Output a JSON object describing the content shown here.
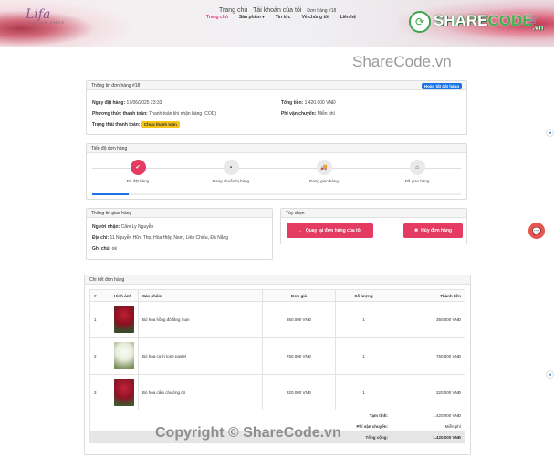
{
  "header": {
    "logo_text": "Lifa",
    "logo_sub": "FLOWER SHOP",
    "breadcrumb": [
      "Trang chủ",
      "Tài khoản của tôi",
      "Đơn hàng #18"
    ],
    "nav": [
      "Trang chủ",
      "Sản phẩm ▾",
      "Tin tức",
      "Về chúng tôi",
      "Liên hệ"
    ],
    "brand_prefix": "SHARE",
    "brand_mid": "CODE",
    "brand_suffix": ".vn",
    "cart_icon": "cart-icon"
  },
  "watermark": "ShareCode.vn",
  "order_info": {
    "title": "Thông tin đơn hàng #18",
    "status_badge": "Hoàn tất đặt hàng",
    "order_date_label": "Ngày đặt hàng:",
    "order_date": "17/06/2025 23:33",
    "payment_label": "Phương thức thanh toán:",
    "payment": "Thanh toán khi nhận hàng (COD)",
    "pay_status_label": "Trạng thái thanh toán:",
    "pay_status": "Chưa thanh toán",
    "total_label": "Tổng tiền:",
    "total": "1.420.000 VNĐ",
    "shipping_label": "Phí vận chuyển:",
    "shipping": "Miễn phí"
  },
  "progress": {
    "title": "Tiến độ đơn hàng",
    "steps": [
      "Đã đặt hàng",
      "Đang chuẩn bị hàng",
      "Đang giao hàng",
      "Đã giao hàng"
    ],
    "fill_fraction": 0.1
  },
  "shipping_info": {
    "title": "Thông tin giao hàng",
    "receiver_label": "Người nhận:",
    "receiver": "Cẩm Ly Nguyễn",
    "address_label": "Địa chỉ:",
    "address": "11 Nguyễn Hữu Thọ, Hòa Hiệp Nam, Liên Chiểu, Đà Nẵng",
    "note_label": "Ghi chú:",
    "note": "ok"
  },
  "options": {
    "title": "Tùy chọn",
    "back_button": "Quay lại đơn hàng của tôi",
    "cancel_button": "Hủy đơn hàng"
  },
  "details": {
    "title": "Chi tiết đơn hàng",
    "columns": [
      "#",
      "Hình ảnh",
      "Sản phẩm",
      "Đơn giá",
      "Số lượng",
      "Thành tiền"
    ],
    "rows": [
      {
        "idx": "1",
        "name": "Bó hoa hồng đỏ lãng mạn",
        "price": "350.000 VNĐ",
        "qty": "1",
        "amount": "350.000 VNĐ"
      },
      {
        "idx": "2",
        "name": "Bó hoa cưới tone pastel",
        "price": "750.000 VNĐ",
        "qty": "1",
        "amount": "750.000 VNĐ"
      },
      {
        "idx": "3",
        "name": "Bó hoa cẩm chướng đỏ",
        "price": "320.000 VNĐ",
        "qty": "1",
        "amount": "320.000 VNĐ"
      }
    ],
    "subtotal_label": "Tạm tính:",
    "subtotal": "1.420.000 VNĐ",
    "ship_label": "Phí vận chuyển:",
    "ship": "Miễn phí",
    "grand_label": "Tổng cộng:",
    "grand": "1.420.000 VNĐ"
  },
  "copyright": "Copyright © ShareCode.vn",
  "colors": {
    "accent": "#e3417a",
    "badge_blue": "#1a73e8",
    "badge_yellow": "#f5c518",
    "primary": "#e33b62",
    "progress": "#1a73e8"
  }
}
